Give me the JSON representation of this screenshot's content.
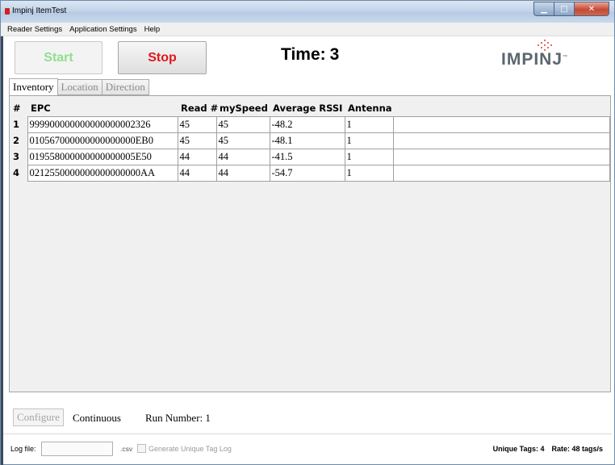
{
  "window": {
    "title": "Impinj ItemTest"
  },
  "menu": [
    "Reader Settings",
    "Application Settings",
    "Help"
  ],
  "controls": {
    "start_label": "Start",
    "stop_label": "Stop"
  },
  "timer": {
    "label": "Time:",
    "value": "3"
  },
  "logo": {
    "text": "IMPINJ",
    "trademark": "™"
  },
  "tabs": [
    "Inventory",
    "Location",
    "Direction"
  ],
  "active_tab": "Inventory",
  "table": {
    "headers": [
      "#",
      "EPC",
      "Read #",
      "mySpeed",
      "Average RSSI",
      "Antenna"
    ],
    "rows": [
      [
        "1",
        "999900000000000000002326",
        "45",
        "45",
        "-48.2",
        "1"
      ],
      [
        "2",
        "010567000000000000000EB0",
        "45",
        "45",
        "-48.1",
        "1"
      ],
      [
        "3",
        "019558000000000000005E50",
        "44",
        "44",
        "-41.5",
        "1"
      ],
      [
        "4",
        "0212550000000000000000AA",
        "44",
        "44",
        "-54.7",
        "1"
      ]
    ]
  },
  "bottom": {
    "configure_label": "Configure",
    "mode": "Continuous",
    "run_number_label": "Run Number: 1",
    "log_file_label": "Log file:",
    "log_file_value": "",
    "csv_label": ".csv",
    "unique_log_label": "Generate Unique Tag Log",
    "unique_tags": "Unique Tags: 4",
    "rate": "Rate: 48 tags/s"
  },
  "colors": {
    "start_disabled": "#8fe08f",
    "stop": "#e0181b",
    "logo": "#5a6670",
    "logo_dots": "#e0383b"
  }
}
